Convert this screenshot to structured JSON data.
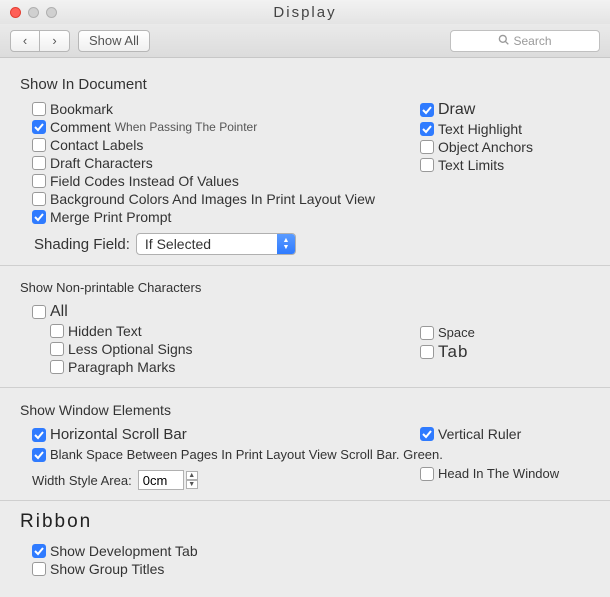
{
  "window": {
    "title": "Display"
  },
  "toolbar": {
    "back": "‹",
    "forward": "›",
    "showAll": "Show All",
    "searchPlaceholder": "Search"
  },
  "sections": {
    "showInDoc": {
      "title": "Show In Document",
      "bookmark": "Bookmark",
      "comment": "Comment",
      "commentSub": "When Passing The Pointer",
      "contactLabels": "Contact Labels",
      "draftChars": "Draft Characters",
      "fieldCodes": "Field Codes Instead Of Values",
      "bgColors": "Background Colors And Images In Print Layout View",
      "mergePrint": "Merge Print Prompt",
      "draw": "Draw",
      "textHighlight": "Text Highlight",
      "objectAnchors": "Object Anchors",
      "textLimits": "Text Limits",
      "shadingLabel": "Shading Field:",
      "shadingValue": "If Selected"
    },
    "nonPrint": {
      "title": "Show Non-printable Characters",
      "all": "All",
      "hidden": "Hidden Text",
      "lessOpt": "Less Optional Signs",
      "paragraph": "Paragraph Marks",
      "space": "Space",
      "tab": "Tab"
    },
    "windowEl": {
      "title": "Show Window Elements",
      "hScroll": "Horizontal Scroll Bar",
      "vRuler": "Vertical Ruler",
      "blankSpace": "Blank Space Between Pages In Print Layout View Scroll Bar. Green.",
      "headInWindow": "Head In The Window",
      "widthLabel": "Width Style Area:",
      "widthValue": "0cm"
    },
    "ribbon": {
      "title": "Ribbon",
      "devTab": "Show Development Tab",
      "groupTitles": "Show Group Titles"
    }
  },
  "checks": {
    "bookmark": false,
    "comment": true,
    "contactLabels": false,
    "draftChars": false,
    "fieldCodes": false,
    "bgColors": false,
    "mergePrint": true,
    "draw": true,
    "textHighlight": true,
    "objectAnchors": false,
    "textLimits": false,
    "all": false,
    "hidden": false,
    "lessOpt": false,
    "paragraph": false,
    "space": false,
    "tab": false,
    "hScroll": true,
    "vRuler": true,
    "blankSpace": true,
    "headInWindow": false,
    "devTab": true,
    "groupTitles": false
  }
}
